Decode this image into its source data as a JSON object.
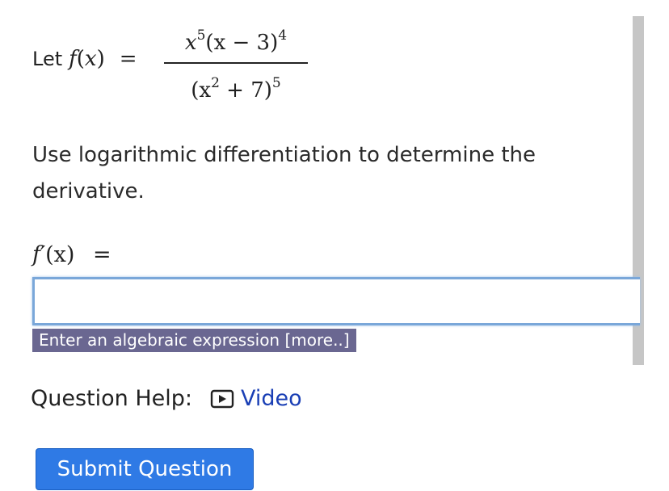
{
  "question": {
    "let_label": "Let",
    "function_name": "f",
    "variable": "x",
    "equals": "=",
    "numerator": {
      "base": "x",
      "base_exp": "5",
      "factor": "(x − 3)",
      "factor_exp": "4"
    },
    "denominator": {
      "base": "(x",
      "base_exp": "2",
      "rest": " + 7)",
      "exp": "5"
    },
    "prompt": "Use logarithmic differentiation to determine the derivative."
  },
  "answer": {
    "label_fn": "f′",
    "label_arg": "(x)",
    "label_eq": "=",
    "value": "",
    "placeholder": "",
    "hint": "Enter an algebraic expression [more..]"
  },
  "help": {
    "label": "Question Help:",
    "video_label": "Video",
    "icon": "play-video-icon"
  },
  "submit_label": "Submit Question",
  "colors": {
    "submit_bg": "#2f7ae5",
    "hint_bg": "#6a6791",
    "link": "#1a3fb5",
    "input_border": "#7aa7d9"
  }
}
